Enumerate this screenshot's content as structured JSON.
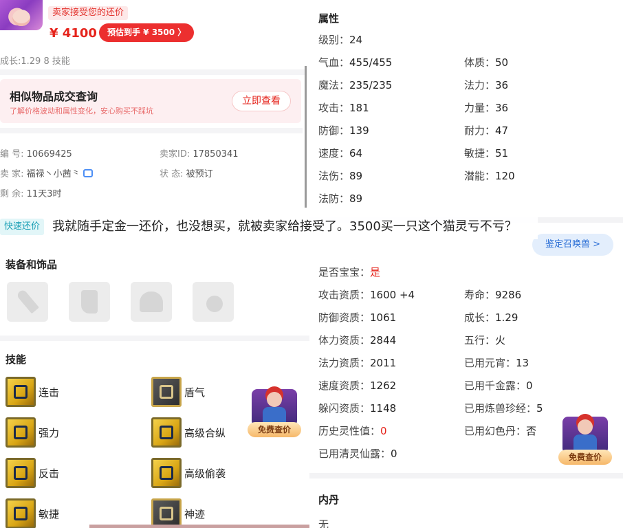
{
  "left": {
    "seller_accept": "卖家接受您的还价",
    "price": "¥ 4100",
    "estimate_button": "预估到手 ¥ 3500 〉",
    "growth_skills": "成长:1.29 8 技能",
    "similar": {
      "title": "相似物品成交查询",
      "subtitle": "了解价格波动和属性变化，安心购买不踩坑",
      "button": "立即查看"
    },
    "info": {
      "id_label": "编 号: ",
      "id_value": "10669425",
      "seller_id_label": "卖家ID: ",
      "seller_id_value": "17850341",
      "seller_label": "卖 家: ",
      "seller_value": "福禄丶小茜⺀",
      "status_label": "状 态: ",
      "status_value": "被预订",
      "remain_label": "剩 余: ",
      "remain_value": "11天3时"
    },
    "quick_offer": "快速还价",
    "equipment_title": "装备和饰品",
    "skills_title": "技能",
    "skills": [
      "连击",
      "盾气",
      "强力",
      "高级合纵",
      "反击",
      "高级偷袭",
      "敏捷",
      "神迹"
    ]
  },
  "question": "我就随手定金一还价，也没想买，就被卖家给接受了。3500买一只这个猫灵亏不亏？",
  "right": {
    "attributes_title": "属性",
    "level_label": "级别：",
    "level_value": "24",
    "attrs": [
      {
        "label": "气血：",
        "value": "455/455"
      },
      {
        "label": "体质：",
        "value": "50"
      },
      {
        "label": "魔法：",
        "value": "235/235"
      },
      {
        "label": "法力：",
        "value": "36"
      },
      {
        "label": "攻击：",
        "value": "181"
      },
      {
        "label": "力量：",
        "value": "36"
      },
      {
        "label": "防御：",
        "value": "139"
      },
      {
        "label": "耐力：",
        "value": "47"
      },
      {
        "label": "速度：",
        "value": "64"
      },
      {
        "label": "敏捷：",
        "value": "51"
      },
      {
        "label": "法伤：",
        "value": "89"
      },
      {
        "label": "潜能：",
        "value": "120"
      },
      {
        "label": "法防：",
        "value": "89"
      }
    ],
    "appraise_button": "鉴定召唤兽 >",
    "baby_label": "是否宝宝：",
    "baby_value": "是",
    "qualities": [
      {
        "label": "攻击资质：",
        "value": "1600 +4"
      },
      {
        "label": "寿命：",
        "value": "9286"
      },
      {
        "label": "防御资质：",
        "value": "1061"
      },
      {
        "label": "成长：",
        "value": "1.29"
      },
      {
        "label": "体力资质：",
        "value": "2844"
      },
      {
        "label": "五行：",
        "value": "火"
      },
      {
        "label": "法力资质：",
        "value": "2011"
      },
      {
        "label": "已用元宵：",
        "value": "13"
      },
      {
        "label": "速度资质：",
        "value": "1262"
      },
      {
        "label": "已用千金露：",
        "value": "0"
      },
      {
        "label": "躲闪资质：",
        "value": "1148"
      },
      {
        "label": "已用炼兽珍经：",
        "value": "5"
      },
      {
        "label": "历史灵性值：",
        "value": "0"
      },
      {
        "label": "已用幻色丹：",
        "value": "否"
      },
      {
        "label": "已用清灵仙露：",
        "value": "0"
      }
    ],
    "neidan_title": "内丹",
    "neidan_value": "无"
  },
  "free_badge_label": "免费查价"
}
